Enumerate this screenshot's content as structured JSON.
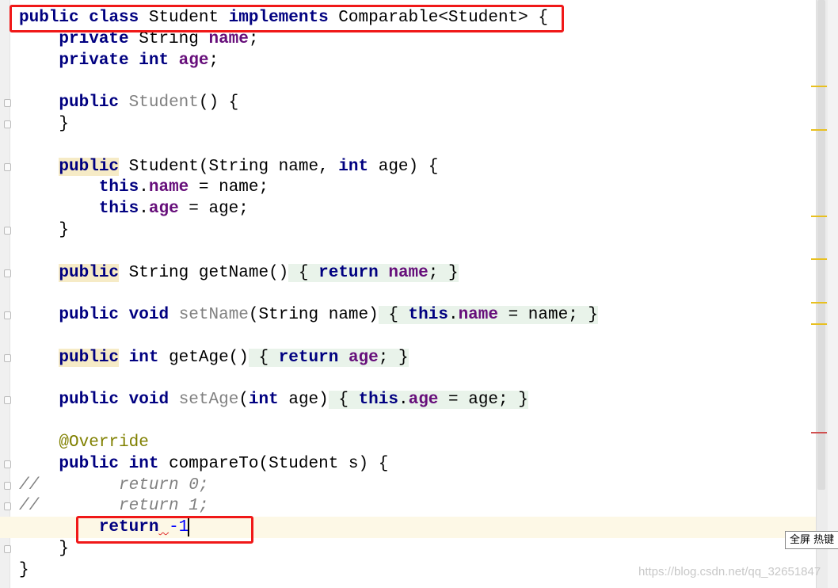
{
  "editor": {
    "current_line": 24,
    "lines": [
      [
        [
          "kw",
          "public"
        ],
        [
          "",
          ""
        ],
        [
          "",
          " "
        ],
        [
          "kw",
          "class"
        ],
        [
          "",
          " Student "
        ],
        [
          "kw",
          "implements"
        ],
        [
          "",
          " Comparable<Student> {"
        ]
      ],
      [
        [
          "",
          "    "
        ],
        [
          "kw",
          "private"
        ],
        [
          "",
          " String "
        ],
        [
          "fld",
          "name"
        ],
        [
          "",
          ";"
        ]
      ],
      [
        [
          "",
          "    "
        ],
        [
          "kw",
          "private"
        ],
        [
          "",
          " "
        ],
        [
          "kw",
          "int"
        ],
        [
          "",
          " "
        ],
        [
          "fld",
          "age"
        ],
        [
          "",
          ";"
        ]
      ],
      [],
      [
        [
          "",
          "    "
        ],
        [
          "kw",
          "public"
        ],
        [
          "",
          " "
        ],
        [
          "unused",
          "Student"
        ],
        [
          "",
          "() {"
        ]
      ],
      [
        [
          "",
          "    }"
        ]
      ],
      [],
      [
        [
          "",
          "    "
        ],
        [
          "kw hl",
          "public"
        ],
        [
          "",
          " Student(String name, "
        ],
        [
          "kw",
          "int"
        ],
        [
          "",
          " age) {"
        ]
      ],
      [
        [
          "",
          "        "
        ],
        [
          "kw",
          "this"
        ],
        [
          "",
          "."
        ],
        [
          "fld",
          "name"
        ],
        [
          "",
          " = name;"
        ]
      ],
      [
        [
          "",
          "        "
        ],
        [
          "kw",
          "this"
        ],
        [
          "",
          "."
        ],
        [
          "fld",
          "age"
        ],
        [
          "",
          " = age;"
        ]
      ],
      [
        [
          "",
          "    }"
        ]
      ],
      [],
      [
        [
          "",
          "    "
        ],
        [
          "kw hl",
          "public"
        ],
        [
          "",
          " String getName()"
        ],
        [
          "fold",
          " { "
        ],
        [
          "kw fold",
          "return"
        ],
        [
          "fold",
          " "
        ],
        [
          "fld fold",
          "name"
        ],
        [
          "fold",
          "; }"
        ]
      ],
      [],
      [
        [
          "",
          "    "
        ],
        [
          "kw",
          "public"
        ],
        [
          "",
          " "
        ],
        [
          "kw",
          "void"
        ],
        [
          "",
          " "
        ],
        [
          "unused",
          "setName"
        ],
        [
          "",
          "(String name)"
        ],
        [
          "fold",
          " { "
        ],
        [
          "kw fold",
          "this"
        ],
        [
          "fold",
          "."
        ],
        [
          "fld fold",
          "name"
        ],
        [
          "fold",
          " = name; }"
        ]
      ],
      [],
      [
        [
          "",
          "    "
        ],
        [
          "kw hl",
          "public"
        ],
        [
          "",
          " "
        ],
        [
          "kw",
          "int"
        ],
        [
          "",
          " getAge()"
        ],
        [
          "fold",
          " { "
        ],
        [
          "kw fold",
          "return"
        ],
        [
          "fold",
          " "
        ],
        [
          "fld fold",
          "age"
        ],
        [
          "fold",
          "; }"
        ]
      ],
      [],
      [
        [
          "",
          "    "
        ],
        [
          "kw",
          "public"
        ],
        [
          "",
          " "
        ],
        [
          "kw",
          "void"
        ],
        [
          "",
          " "
        ],
        [
          "unused",
          "setAge"
        ],
        [
          "",
          "("
        ],
        [
          "kw",
          "int"
        ],
        [
          "",
          " age)"
        ],
        [
          "fold",
          " { "
        ],
        [
          "kw fold",
          "this"
        ],
        [
          "fold",
          "."
        ],
        [
          "fld fold",
          "age"
        ],
        [
          "fold",
          " = age; }"
        ]
      ],
      [],
      [
        [
          "",
          "    "
        ],
        [
          "ann",
          "@Override"
        ]
      ],
      [
        [
          "",
          "    "
        ],
        [
          "kw",
          "public"
        ],
        [
          "",
          " "
        ],
        [
          "kw",
          "int"
        ],
        [
          "",
          " compareTo(Student s) {"
        ]
      ],
      [
        [
          "cmt",
          "//        return 0;"
        ]
      ],
      [
        [
          "cmt",
          "//        return 1;"
        ]
      ],
      [
        [
          "",
          "        "
        ],
        [
          "kw",
          "return"
        ],
        [
          "squig",
          " "
        ],
        [
          "num",
          "-1"
        ],
        [
          "caret",
          ""
        ]
      ],
      [
        [
          "",
          "    }"
        ]
      ],
      [
        [
          "",
          "}"
        ]
      ]
    ]
  },
  "fold_markers": [
    4,
    5,
    7,
    10,
    12,
    14,
    16,
    18,
    21,
    22,
    23,
    25
  ],
  "error_stripe_marks": [
    {
      "line": 4,
      "color": "#e8c020"
    },
    {
      "line": 6,
      "color": "#e8c020"
    },
    {
      "line": 10,
      "color": "#e8c020"
    },
    {
      "line": 12,
      "color": "#e8c020"
    },
    {
      "line": 14,
      "color": "#e8c020"
    },
    {
      "line": 15,
      "color": "#e8c020"
    },
    {
      "line": 20,
      "color": "#d05050"
    }
  ],
  "tooltip": {
    "text": "全屏 热键"
  },
  "watermark": {
    "text": "https://blog.csdn.net/qq_32651847"
  },
  "colors": {
    "highlight_box": "#f01818",
    "keyword": "#000080",
    "field": "#660e7a",
    "current_line": "#fdf8e6"
  }
}
